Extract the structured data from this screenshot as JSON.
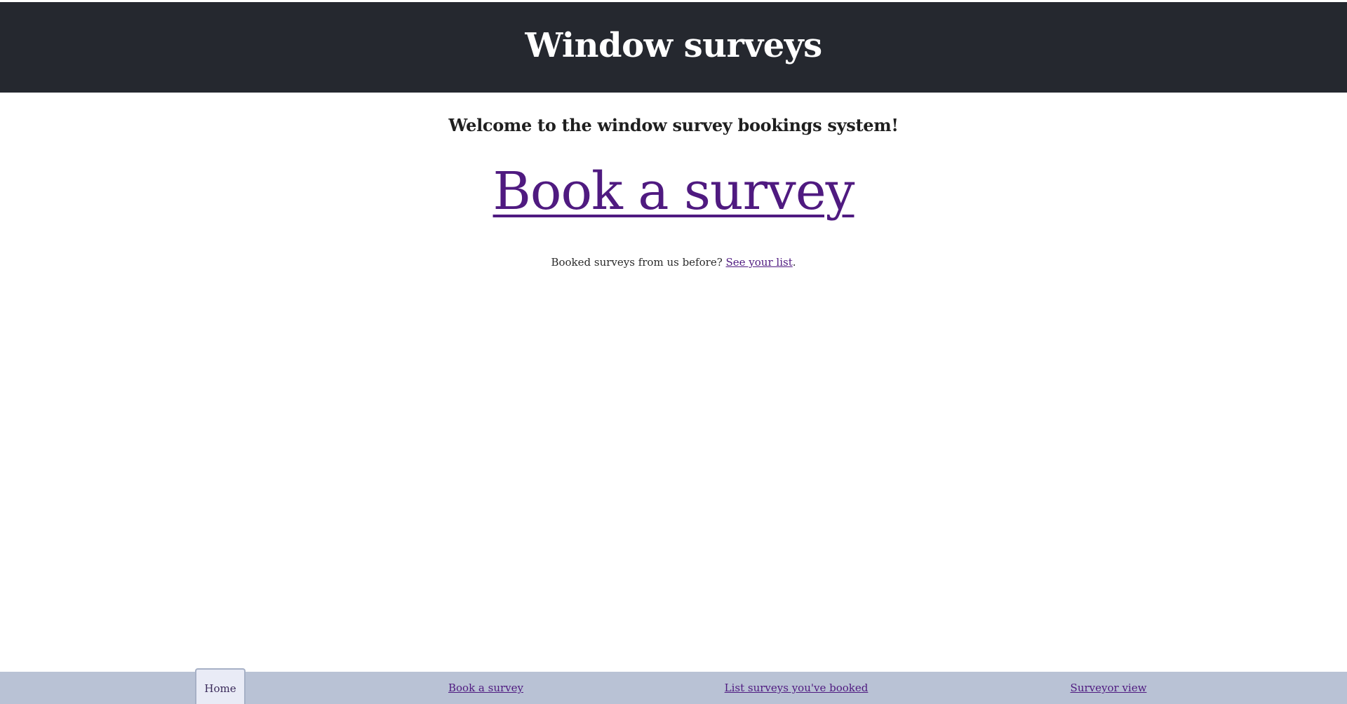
{
  "header": {
    "title": "Window surveys"
  },
  "main": {
    "welcome": "Welcome to the window survey bookings system!",
    "book_link": "Book a survey",
    "returning_prefix": "Booked surveys from us before? ",
    "returning_link": "See your list",
    "returning_suffix": "."
  },
  "footer_nav": {
    "items": [
      {
        "label": "Home",
        "active": true
      },
      {
        "label": "Book a survey",
        "active": false
      },
      {
        "label": "List surveys you've booked",
        "active": false
      },
      {
        "label": "Surveyor view",
        "active": false
      }
    ]
  },
  "colors": {
    "header_bg": "#25282f",
    "link": "#4f1a80",
    "nav_bg": "#b9c2d5",
    "nav_active_bg": "#e9ebf6"
  }
}
